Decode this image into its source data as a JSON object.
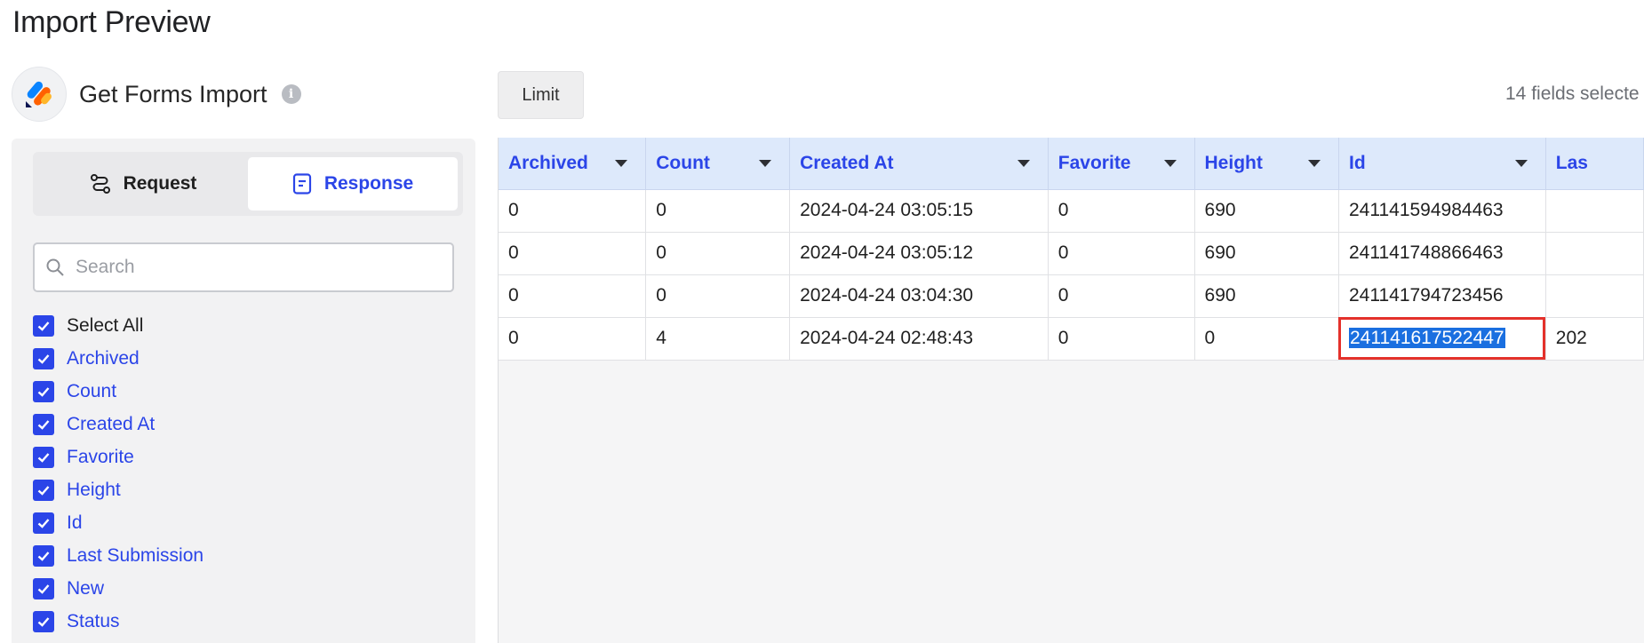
{
  "page": {
    "title": "Import Preview"
  },
  "app": {
    "name": "Get Forms Import",
    "info_icon": "info-icon"
  },
  "tabs": [
    {
      "label": "Request",
      "icon": "request-flow-icon",
      "active": false
    },
    {
      "label": "Response",
      "icon": "document-icon",
      "active": true
    }
  ],
  "search": {
    "placeholder": "Search",
    "value": ""
  },
  "fields": {
    "select_all": "Select All",
    "items": [
      "Archived",
      "Count",
      "Created At",
      "Favorite",
      "Height",
      "Id",
      "Last Submission",
      "New",
      "Status"
    ]
  },
  "toolbar": {
    "limit_label": "Limit",
    "fields_selected": "14 fields selecte"
  },
  "table": {
    "columns": [
      "Archived",
      "Count",
      "Created At",
      "Favorite",
      "Height",
      "Id",
      "Las"
    ],
    "rows": [
      [
        "0",
        "0",
        "2024-04-24 03:05:15",
        "0",
        "690",
        "241141594984463",
        ""
      ],
      [
        "0",
        "0",
        "2024-04-24 03:05:12",
        "0",
        "690",
        "241141748866463",
        ""
      ],
      [
        "0",
        "0",
        "2024-04-24 03:04:30",
        "0",
        "690",
        "241141794723456",
        ""
      ],
      [
        "0",
        "4",
        "2024-04-24 02:48:43",
        "0",
        "0",
        "241141617522447",
        "202"
      ]
    ],
    "selected_cell": {
      "row": 3,
      "col": 5
    }
  },
  "colors": {
    "accent": "#2b45e8",
    "header_bg": "#dde9fb",
    "selection_outline": "#e4312b",
    "text_selection": "#1a6fe0"
  }
}
